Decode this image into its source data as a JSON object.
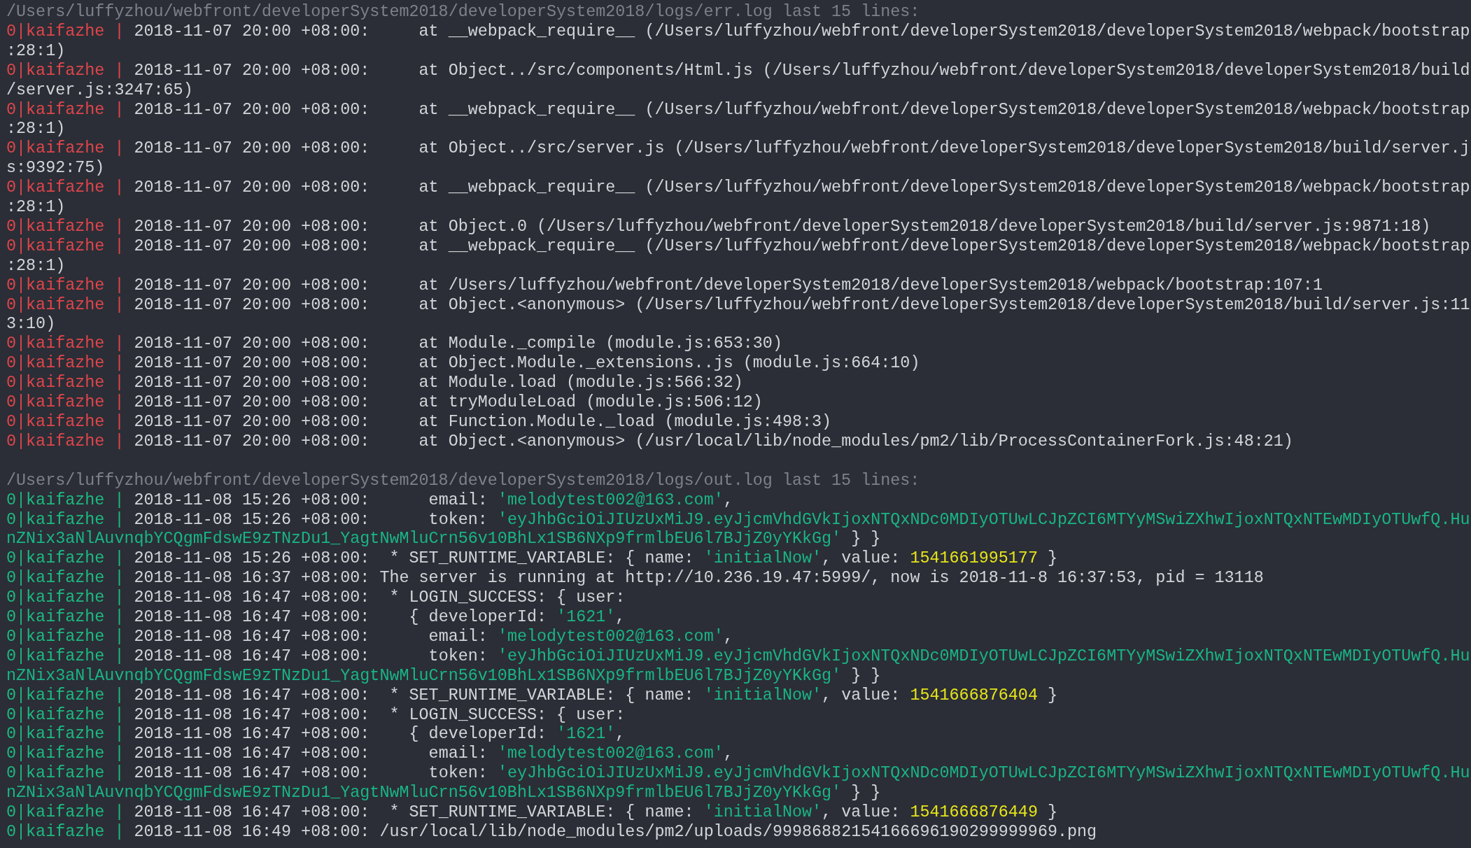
{
  "sections": [
    {
      "kind": "err",
      "header": "/Users/luffyzhou/webfront/developerSystem2018/developerSystem2018/logs/err.log last 15 lines:",
      "lines": [
        {
          "app": "0|kaifazhe |",
          "time": "2018-11-07 20:00 +08:00:",
          "message": [
            {
              "kind": "plain",
              "text": "     at __webpack_require__ (/Users/luffyzhou/webfront/developerSystem2018/developerSystem2018/webpack/bootstrap:28:1)"
            }
          ]
        },
        {
          "app": "0|kaifazhe |",
          "time": "2018-11-07 20:00 +08:00:",
          "message": [
            {
              "kind": "plain",
              "text": "     at Object../src/components/Html.js (/Users/luffyzhou/webfront/developerSystem2018/developerSystem2018/build/server.js:3247:65)"
            }
          ]
        },
        {
          "app": "0|kaifazhe |",
          "time": "2018-11-07 20:00 +08:00:",
          "message": [
            {
              "kind": "plain",
              "text": "     at __webpack_require__ (/Users/luffyzhou/webfront/developerSystem2018/developerSystem2018/webpack/bootstrap:28:1)"
            }
          ]
        },
        {
          "app": "0|kaifazhe |",
          "time": "2018-11-07 20:00 +08:00:",
          "message": [
            {
              "kind": "plain",
              "text": "     at Object../src/server.js (/Users/luffyzhou/webfront/developerSystem2018/developerSystem2018/build/server.js:9392:75)"
            }
          ]
        },
        {
          "app": "0|kaifazhe |",
          "time": "2018-11-07 20:00 +08:00:",
          "message": [
            {
              "kind": "plain",
              "text": "     at __webpack_require__ (/Users/luffyzhou/webfront/developerSystem2018/developerSystem2018/webpack/bootstrap:28:1)"
            }
          ]
        },
        {
          "app": "0|kaifazhe |",
          "time": "2018-11-07 20:00 +08:00:",
          "message": [
            {
              "kind": "plain",
              "text": "     at Object.0 (/Users/luffyzhou/webfront/developerSystem2018/developerSystem2018/build/server.js:9871:18)"
            }
          ]
        },
        {
          "app": "0|kaifazhe |",
          "time": "2018-11-07 20:00 +08:00:",
          "message": [
            {
              "kind": "plain",
              "text": "     at __webpack_require__ (/Users/luffyzhou/webfront/developerSystem2018/developerSystem2018/webpack/bootstrap:28:1)"
            }
          ]
        },
        {
          "app": "0|kaifazhe |",
          "time": "2018-11-07 20:00 +08:00:",
          "message": [
            {
              "kind": "plain",
              "text": "     at /Users/luffyzhou/webfront/developerSystem2018/developerSystem2018/webpack/bootstrap:107:1"
            }
          ]
        },
        {
          "app": "0|kaifazhe |",
          "time": "2018-11-07 20:00 +08:00:",
          "message": [
            {
              "kind": "plain",
              "text": "     at Object.<anonymous> (/Users/luffyzhou/webfront/developerSystem2018/developerSystem2018/build/server.js:113:10)"
            }
          ]
        },
        {
          "app": "0|kaifazhe |",
          "time": "2018-11-07 20:00 +08:00:",
          "message": [
            {
              "kind": "plain",
              "text": "     at Module._compile (module.js:653:30)"
            }
          ]
        },
        {
          "app": "0|kaifazhe |",
          "time": "2018-11-07 20:00 +08:00:",
          "message": [
            {
              "kind": "plain",
              "text": "     at Object.Module._extensions..js (module.js:664:10)"
            }
          ]
        },
        {
          "app": "0|kaifazhe |",
          "time": "2018-11-07 20:00 +08:00:",
          "message": [
            {
              "kind": "plain",
              "text": "     at Module.load (module.js:566:32)"
            }
          ]
        },
        {
          "app": "0|kaifazhe |",
          "time": "2018-11-07 20:00 +08:00:",
          "message": [
            {
              "kind": "plain",
              "text": "     at tryModuleLoad (module.js:506:12)"
            }
          ]
        },
        {
          "app": "0|kaifazhe |",
          "time": "2018-11-07 20:00 +08:00:",
          "message": [
            {
              "kind": "plain",
              "text": "     at Function.Module._load (module.js:498:3)"
            }
          ]
        },
        {
          "app": "0|kaifazhe |",
          "time": "2018-11-07 20:00 +08:00:",
          "message": [
            {
              "kind": "plain",
              "text": "     at Object.<anonymous> (/usr/local/lib/node_modules/pm2/lib/ProcessContainerFork.js:48:21)"
            }
          ]
        }
      ]
    },
    {
      "kind": "out",
      "header": "/Users/luffyzhou/webfront/developerSystem2018/developerSystem2018/logs/out.log last 15 lines:",
      "lines": [
        {
          "app": "0|kaifazhe |",
          "time": "2018-11-08 15:26 +08:00:",
          "message": [
            {
              "kind": "plain",
              "text": "      email: "
            },
            {
              "kind": "string",
              "text": "'melodytest002@163.com'"
            },
            {
              "kind": "plain",
              "text": ","
            }
          ]
        },
        {
          "app": "0|kaifazhe |",
          "time": "2018-11-08 15:26 +08:00:",
          "message": [
            {
              "kind": "plain",
              "text": "      token: "
            },
            {
              "kind": "string",
              "text": "'eyJhbGciOiJIUzUxMiJ9.eyJjcmVhdGVkIjoxNTQxNDc0MDIyOTUwLCJpZCI6MTYyMSwiZXhwIjoxNTQxNTEwMDIyOTUwfQ.HunZNix3aNlAuvnqbYCQgmFdswE9zTNzDu1_YagtNwMluCrn56v10BhLx1SB6NXp9frmlbEU6l7BJjZ0yYKkGg'"
            },
            {
              "kind": "plain",
              "text": " } }"
            }
          ]
        },
        {
          "app": "0|kaifazhe |",
          "time": "2018-11-08 15:26 +08:00:",
          "message": [
            {
              "kind": "plain",
              "text": "  * SET_RUNTIME_VARIABLE: { name: "
            },
            {
              "kind": "string",
              "text": "'initialNow'"
            },
            {
              "kind": "plain",
              "text": ", value: "
            },
            {
              "kind": "number",
              "text": "1541661995177"
            },
            {
              "kind": "plain",
              "text": " }"
            }
          ]
        },
        {
          "app": "0|kaifazhe |",
          "time": "2018-11-08 16:37 +08:00:",
          "message": [
            {
              "kind": "plain",
              "text": " The server is running at http://10.236.19.47:5999/, now is 2018-11-8 16:37:53, pid = 13118"
            }
          ]
        },
        {
          "app": "0|kaifazhe |",
          "time": "2018-11-08 16:47 +08:00:",
          "message": [
            {
              "kind": "plain",
              "text": "  * LOGIN_SUCCESS: { user:"
            }
          ]
        },
        {
          "app": "0|kaifazhe |",
          "time": "2018-11-08 16:47 +08:00:",
          "message": [
            {
              "kind": "plain",
              "text": "    { developerId: "
            },
            {
              "kind": "string",
              "text": "'1621'"
            },
            {
              "kind": "plain",
              "text": ","
            }
          ]
        },
        {
          "app": "0|kaifazhe |",
          "time": "2018-11-08 16:47 +08:00:",
          "message": [
            {
              "kind": "plain",
              "text": "      email: "
            },
            {
              "kind": "string",
              "text": "'melodytest002@163.com'"
            },
            {
              "kind": "plain",
              "text": ","
            }
          ]
        },
        {
          "app": "0|kaifazhe |",
          "time": "2018-11-08 16:47 +08:00:",
          "message": [
            {
              "kind": "plain",
              "text": "      token: "
            },
            {
              "kind": "string",
              "text": "'eyJhbGciOiJIUzUxMiJ9.eyJjcmVhdGVkIjoxNTQxNDc0MDIyOTUwLCJpZCI6MTYyMSwiZXhwIjoxNTQxNTEwMDIyOTUwfQ.HunZNix3aNlAuvnqbYCQgmFdswE9zTNzDu1_YagtNwMluCrn56v10BhLx1SB6NXp9frmlbEU6l7BJjZ0yYKkGg'"
            },
            {
              "kind": "plain",
              "text": " } }"
            }
          ]
        },
        {
          "app": "0|kaifazhe |",
          "time": "2018-11-08 16:47 +08:00:",
          "message": [
            {
              "kind": "plain",
              "text": "  * SET_RUNTIME_VARIABLE: { name: "
            },
            {
              "kind": "string",
              "text": "'initialNow'"
            },
            {
              "kind": "plain",
              "text": ", value: "
            },
            {
              "kind": "number",
              "text": "1541666876404"
            },
            {
              "kind": "plain",
              "text": " }"
            }
          ]
        },
        {
          "app": "0|kaifazhe |",
          "time": "2018-11-08 16:47 +08:00:",
          "message": [
            {
              "kind": "plain",
              "text": "  * LOGIN_SUCCESS: { user:"
            }
          ]
        },
        {
          "app": "0|kaifazhe |",
          "time": "2018-11-08 16:47 +08:00:",
          "message": [
            {
              "kind": "plain",
              "text": "    { developerId: "
            },
            {
              "kind": "string",
              "text": "'1621'"
            },
            {
              "kind": "plain",
              "text": ","
            }
          ]
        },
        {
          "app": "0|kaifazhe |",
          "time": "2018-11-08 16:47 +08:00:",
          "message": [
            {
              "kind": "plain",
              "text": "      email: "
            },
            {
              "kind": "string",
              "text": "'melodytest002@163.com'"
            },
            {
              "kind": "plain",
              "text": ","
            }
          ]
        },
        {
          "app": "0|kaifazhe |",
          "time": "2018-11-08 16:47 +08:00:",
          "message": [
            {
              "kind": "plain",
              "text": "      token: "
            },
            {
              "kind": "string",
              "text": "'eyJhbGciOiJIUzUxMiJ9.eyJjcmVhdGVkIjoxNTQxNDc0MDIyOTUwLCJpZCI6MTYyMSwiZXhwIjoxNTQxNTEwMDIyOTUwfQ.HunZNix3aNlAuvnqbYCQgmFdswE9zTNzDu1_YagtNwMluCrn56v10BhLx1SB6NXp9frmlbEU6l7BJjZ0yYKkGg'"
            },
            {
              "kind": "plain",
              "text": " } }"
            }
          ]
        },
        {
          "app": "0|kaifazhe |",
          "time": "2018-11-08 16:47 +08:00:",
          "message": [
            {
              "kind": "plain",
              "text": "  * SET_RUNTIME_VARIABLE: { name: "
            },
            {
              "kind": "string",
              "text": "'initialNow'"
            },
            {
              "kind": "plain",
              "text": ", value: "
            },
            {
              "kind": "number",
              "text": "1541666876449"
            },
            {
              "kind": "plain",
              "text": " }"
            }
          ]
        },
        {
          "app": "0|kaifazhe |",
          "time": "2018-11-08 16:49 +08:00:",
          "message": [
            {
              "kind": "plain",
              "text": " /usr/local/lib/node_modules/pm2/uploads/99986882154166696190299999969.png"
            }
          ]
        }
      ]
    }
  ]
}
